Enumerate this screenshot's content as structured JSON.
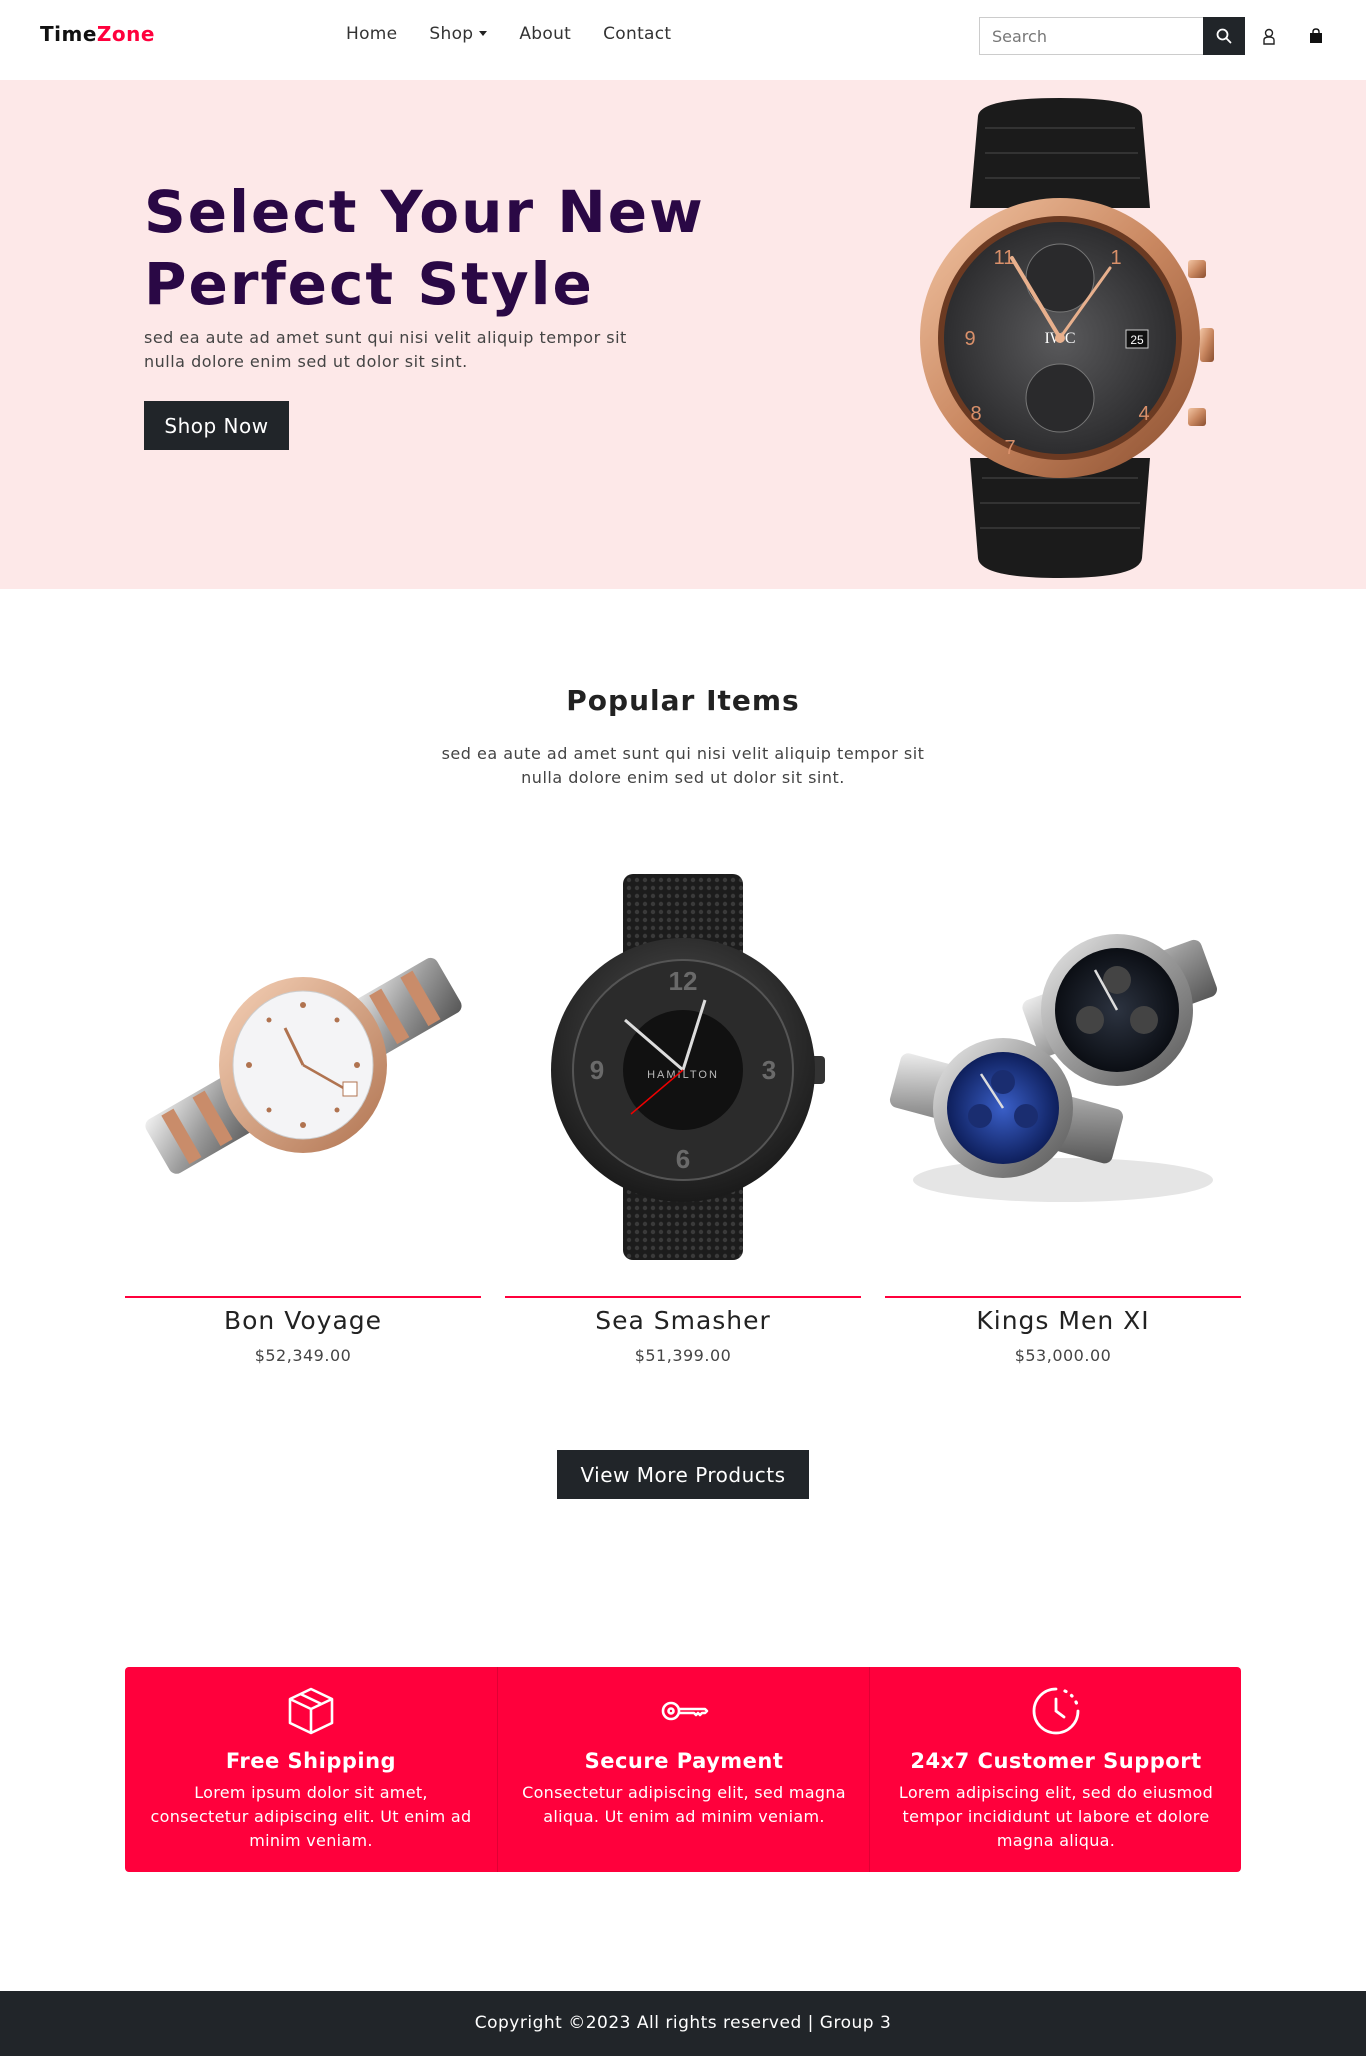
{
  "nav": {
    "brand_first": "Time",
    "brand_second": "Zone",
    "links": [
      "Home",
      "Shop",
      "About",
      "Contact"
    ],
    "search_placeholder": "Search",
    "icons": [
      "search-icon",
      "user-icon",
      "shopping-bag-icon"
    ]
  },
  "hero": {
    "title_line1": "Select Your New",
    "title_line2": "Perfect Style",
    "subtitle": "sed ea aute ad amet sunt qui nisi velit aliquip tempor sit nulla dolore enim sed ut dolor sit sint.",
    "button": "Shop Now"
  },
  "popular": {
    "title": "Popular Items",
    "subtitle": "sed ea aute ad amet sunt qui nisi velit aliquip tempor sit nulla dolore enim sed ut dolor sit sint.",
    "products": [
      {
        "name": "Bon Voyage",
        "price": "$52,349.00"
      },
      {
        "name": "Sea Smasher",
        "price": "$51,399.00"
      },
      {
        "name": "Kings Men XI",
        "price": "$53,000.00"
      }
    ],
    "more_button": "View More Products"
  },
  "features": [
    {
      "icon": "box-icon",
      "title": "Free Shipping",
      "text": "Lorem ipsum dolor sit amet, consectetur adipiscing elit. Ut enim ad minim veniam."
    },
    {
      "icon": "key-icon",
      "title": "Secure Payment",
      "text": "Consectetur adipiscing elit, sed magna aliqua. Ut enim ad minim veniam."
    },
    {
      "icon": "clock-icon",
      "title": "24x7 Customer Support",
      "text": "Lorem adipiscing elit, sed do eiusmod tempor incididunt ut labore et dolore magna aliqua."
    }
  ],
  "footer": {
    "text": "Copyright ©2023 All rights reserved | Group 3"
  },
  "colors": {
    "accent": "#ff003c",
    "dark": "#212529",
    "hero_bg": "#fde8e8",
    "hero_title": "#2a0845"
  }
}
